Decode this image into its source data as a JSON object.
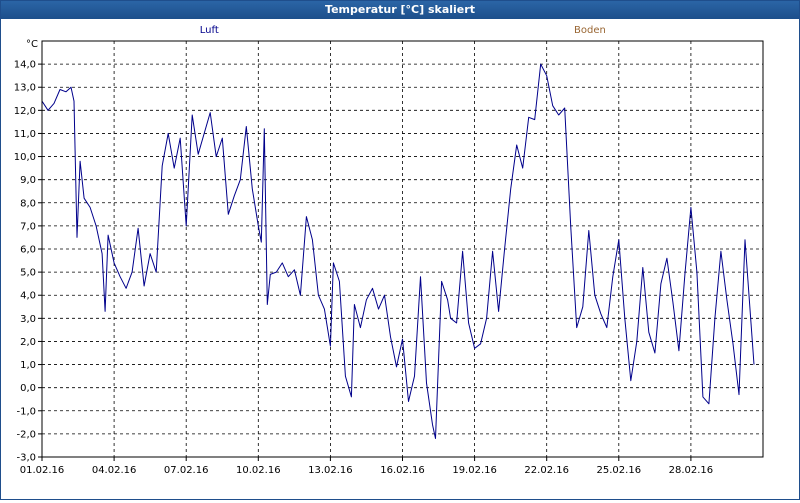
{
  "window": {
    "title": "Temperatur [°C] skaliert"
  },
  "chart_data": {
    "type": "line",
    "title": "Temperatur [°C] skaliert",
    "ylabel": "°C",
    "xlabel": "",
    "ylim": [
      -3.0,
      15.0
    ],
    "yticks": [
      -3.0,
      -2.0,
      -1.0,
      0.0,
      1.0,
      2.0,
      3.0,
      4.0,
      5.0,
      6.0,
      7.0,
      8.0,
      9.0,
      10.0,
      11.0,
      12.0,
      13.0,
      14.0
    ],
    "ytick_labels": [
      "-3,0",
      "-2,0",
      "-1,0",
      "0,0",
      "1,0",
      "2,0",
      "3,0",
      "4,0",
      "5,0",
      "6,0",
      "7,0",
      "8,0",
      "9,0",
      "10,0",
      "11,0",
      "12,0",
      "13,0",
      "14,0"
    ],
    "xlim": [
      "2016-02-01",
      "2016-03-02"
    ],
    "xticks": [
      "2016-02-01",
      "2016-02-04",
      "2016-02-07",
      "2016-02-10",
      "2016-02-13",
      "2016-02-16",
      "2016-02-19",
      "2016-02-22",
      "2016-02-25",
      "2016-02-28"
    ],
    "xtick_labels": [
      "01.02.16",
      "04.02.16",
      "07.02.16",
      "10.02.16",
      "13.02.16",
      "16.02.16",
      "19.02.16",
      "22.02.16",
      "25.02.16",
      "28.02.16"
    ],
    "grid": true,
    "legend": [
      {
        "name": "Luft",
        "color": "#00008b"
      },
      {
        "name": "Boden",
        "color": "#996633"
      }
    ],
    "series": [
      {
        "name": "Luft",
        "color": "#00008b",
        "points": [
          [
            "2016-02-01 00:00",
            12.4
          ],
          [
            "2016-02-01 06:00",
            12.0
          ],
          [
            "2016-02-01 12:00",
            12.3
          ],
          [
            "2016-02-01 18:00",
            12.9
          ],
          [
            "2016-02-02 00:00",
            12.8
          ],
          [
            "2016-02-02 05:00",
            13.0
          ],
          [
            "2016-02-02 08:00",
            12.4
          ],
          [
            "2016-02-02 11:00",
            6.5
          ],
          [
            "2016-02-02 14:00",
            9.8
          ],
          [
            "2016-02-02 18:00",
            8.2
          ],
          [
            "2016-02-03 00:00",
            7.8
          ],
          [
            "2016-02-03 06:00",
            7.0
          ],
          [
            "2016-02-03 12:00",
            5.8
          ],
          [
            "2016-02-03 15:00",
            3.3
          ],
          [
            "2016-02-03 18:00",
            6.6
          ],
          [
            "2016-02-04 00:00",
            5.4
          ],
          [
            "2016-02-04 06:00",
            4.8
          ],
          [
            "2016-02-04 12:00",
            4.3
          ],
          [
            "2016-02-04 18:00",
            5.0
          ],
          [
            "2016-02-05 00:00",
            6.9
          ],
          [
            "2016-02-05 06:00",
            4.4
          ],
          [
            "2016-02-05 12:00",
            5.8
          ],
          [
            "2016-02-05 18:00",
            5.0
          ],
          [
            "2016-02-06 00:00",
            9.6
          ],
          [
            "2016-02-06 06:00",
            11.0
          ],
          [
            "2016-02-06 12:00",
            9.5
          ],
          [
            "2016-02-06 18:00",
            10.8
          ],
          [
            "2016-02-07 00:00",
            7.0
          ],
          [
            "2016-02-07 06:00",
            11.8
          ],
          [
            "2016-02-07 12:00",
            10.1
          ],
          [
            "2016-02-07 18:00",
            11.0
          ],
          [
            "2016-02-08 00:00",
            11.9
          ],
          [
            "2016-02-08 06:00",
            10.0
          ],
          [
            "2016-02-08 12:00",
            10.8
          ],
          [
            "2016-02-08 18:00",
            7.5
          ],
          [
            "2016-02-09 00:00",
            8.3
          ],
          [
            "2016-02-09 06:00",
            9.0
          ],
          [
            "2016-02-09 12:00",
            11.3
          ],
          [
            "2016-02-09 18:00",
            8.6
          ],
          [
            "2016-02-10 00:00",
            7.0
          ],
          [
            "2016-02-10 03:00",
            6.3
          ],
          [
            "2016-02-10 06:00",
            11.2
          ],
          [
            "2016-02-10 09:00",
            3.6
          ],
          [
            "2016-02-10 12:00",
            4.9
          ],
          [
            "2016-02-10 18:00",
            5.0
          ],
          [
            "2016-02-11 00:00",
            5.4
          ],
          [
            "2016-02-11 06:00",
            4.8
          ],
          [
            "2016-02-11 12:00",
            5.1
          ],
          [
            "2016-02-11 18:00",
            4.0
          ],
          [
            "2016-02-12 00:00",
            7.4
          ],
          [
            "2016-02-12 06:00",
            6.4
          ],
          [
            "2016-02-12 12:00",
            4.0
          ],
          [
            "2016-02-12 18:00",
            3.4
          ],
          [
            "2016-02-13 00:00",
            1.8
          ],
          [
            "2016-02-13 03:00",
            5.4
          ],
          [
            "2016-02-13 09:00",
            4.6
          ],
          [
            "2016-02-13 15:00",
            0.5
          ],
          [
            "2016-02-13 21:00",
            -0.4
          ],
          [
            "2016-02-14 00:00",
            3.6
          ],
          [
            "2016-02-14 06:00",
            2.6
          ],
          [
            "2016-02-14 12:00",
            3.8
          ],
          [
            "2016-02-14 18:00",
            4.3
          ],
          [
            "2016-02-15 00:00",
            3.4
          ],
          [
            "2016-02-15 06:00",
            4.0
          ],
          [
            "2016-02-15 12:00",
            2.2
          ],
          [
            "2016-02-15 18:00",
            0.9
          ],
          [
            "2016-02-16 00:00",
            2.1
          ],
          [
            "2016-02-16 06:00",
            -0.6
          ],
          [
            "2016-02-16 12:00",
            0.5
          ],
          [
            "2016-02-16 18:00",
            4.8
          ],
          [
            "2016-02-17 00:00",
            0.2
          ],
          [
            "2016-02-17 06:00",
            -1.6
          ],
          [
            "2016-02-17 09:00",
            -2.2
          ],
          [
            "2016-02-17 15:00",
            4.6
          ],
          [
            "2016-02-17 21:00",
            3.8
          ],
          [
            "2016-02-18 00:00",
            3.0
          ],
          [
            "2016-02-18 06:00",
            2.8
          ],
          [
            "2016-02-18 12:00",
            5.9
          ],
          [
            "2016-02-18 18:00",
            2.8
          ],
          [
            "2016-02-19 00:00",
            1.7
          ],
          [
            "2016-02-19 06:00",
            1.9
          ],
          [
            "2016-02-19 12:00",
            3.0
          ],
          [
            "2016-02-19 18:00",
            5.9
          ],
          [
            "2016-02-20 00:00",
            3.3
          ],
          [
            "2016-02-20 06:00",
            6.0
          ],
          [
            "2016-02-20 12:00",
            8.6
          ],
          [
            "2016-02-20 18:00",
            10.5
          ],
          [
            "2016-02-21 00:00",
            9.5
          ],
          [
            "2016-02-21 06:00",
            11.7
          ],
          [
            "2016-02-21 12:00",
            11.6
          ],
          [
            "2016-02-21 18:00",
            14.0
          ],
          [
            "2016-02-22 00:00",
            13.5
          ],
          [
            "2016-02-22 06:00",
            12.2
          ],
          [
            "2016-02-22 12:00",
            11.8
          ],
          [
            "2016-02-22 18:00",
            12.1
          ],
          [
            "2016-02-23 00:00",
            7.0
          ],
          [
            "2016-02-23 06:00",
            2.6
          ],
          [
            "2016-02-23 12:00",
            3.5
          ],
          [
            "2016-02-23 18:00",
            6.8
          ],
          [
            "2016-02-24 00:00",
            4.0
          ],
          [
            "2016-02-24 06:00",
            3.2
          ],
          [
            "2016-02-24 12:00",
            2.6
          ],
          [
            "2016-02-24 18:00",
            4.8
          ],
          [
            "2016-02-25 00:00",
            6.4
          ],
          [
            "2016-02-25 06:00",
            3.0
          ],
          [
            "2016-02-25 12:00",
            0.3
          ],
          [
            "2016-02-25 18:00",
            2.0
          ],
          [
            "2016-02-26 00:00",
            5.2
          ],
          [
            "2016-02-26 06:00",
            2.4
          ],
          [
            "2016-02-26 12:00",
            1.5
          ],
          [
            "2016-02-26 18:00",
            4.5
          ],
          [
            "2016-02-27 00:00",
            5.6
          ],
          [
            "2016-02-27 06:00",
            3.7
          ],
          [
            "2016-02-27 12:00",
            1.6
          ],
          [
            "2016-02-27 18:00",
            4.9
          ],
          [
            "2016-02-28 00:00",
            7.8
          ],
          [
            "2016-02-28 06:00",
            5.0
          ],
          [
            "2016-02-28 12:00",
            -0.4
          ],
          [
            "2016-02-28 18:00",
            -0.7
          ],
          [
            "2016-02-29 00:00",
            3.0
          ],
          [
            "2016-02-29 06:00",
            5.9
          ],
          [
            "2016-02-29 12:00",
            3.8
          ],
          [
            "2016-02-29 18:00",
            1.9
          ],
          [
            "2016-03-01 00:00",
            -0.3
          ],
          [
            "2016-03-01 06:00",
            6.4
          ],
          [
            "2016-03-01 12:00",
            2.8
          ],
          [
            "2016-03-01 15:00",
            1.0
          ]
        ]
      }
    ]
  }
}
